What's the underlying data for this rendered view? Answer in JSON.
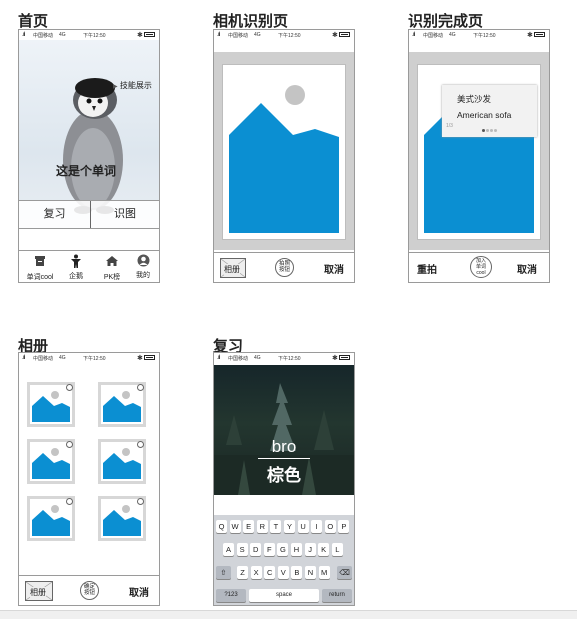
{
  "titles": {
    "home": "首页",
    "camera": "相机识别页",
    "done": "识别完成页",
    "album": "相册",
    "review": "复习"
  },
  "status": {
    "signal": ".ııl",
    "carrier": "中国移动",
    "network": "4G",
    "time": "下午12:50",
    "bluetooth": "✱"
  },
  "home": {
    "skill_label": "技能展示",
    "word_label": "这是个单词",
    "review_button": "复习",
    "recognize_button": "识图",
    "tabs": [
      {
        "label": "单词cool",
        "icon": "archive-icon"
      },
      {
        "label": "企鹅",
        "icon": "person-icon"
      },
      {
        "label": "PK榜",
        "icon": "home-icon"
      },
      {
        "label": "我的",
        "icon": "user-icon"
      }
    ]
  },
  "camera": {
    "album_label": "相册",
    "shutter_label_1": "拍照",
    "shutter_label_2": "按钮",
    "cancel_label": "取消"
  },
  "done": {
    "card_cn": "美式沙发",
    "card_en": "American sofa",
    "card_page": "1/3",
    "retake_label": "重拍",
    "add_label_1": "加入",
    "add_label_2": "单词",
    "add_label_3": "cool",
    "cancel_label": "取消"
  },
  "album": {
    "album_label": "相册",
    "confirm_label_1": "确定",
    "confirm_label_2": "按钮",
    "cancel_label": "取消"
  },
  "review": {
    "word_en": "bro",
    "word_cn": "棕色",
    "keyboard_rows": [
      [
        "Q",
        "W",
        "E",
        "R",
        "T",
        "Y",
        "U",
        "I",
        "O",
        "P"
      ],
      [
        "A",
        "S",
        "D",
        "F",
        "G",
        "H",
        "J",
        "K",
        "L"
      ],
      [
        "Z",
        "X",
        "C",
        "V",
        "B",
        "N",
        "M"
      ]
    ],
    "shift_key": "⇧",
    "delete_key": "⌫",
    "num_key": "?123",
    "space_key": "space",
    "return_key": "return"
  },
  "colors": {
    "accent_blue": "#0b8fd2",
    "placeholder_gray": "#d6d6d6",
    "sun_gray": "#c4c4c4",
    "forest_dark": "#1d2a2a"
  }
}
